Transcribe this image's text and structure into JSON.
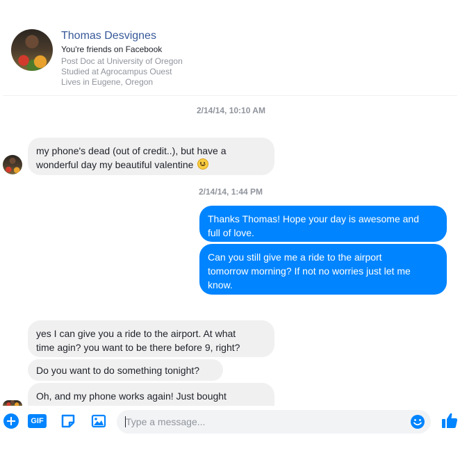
{
  "profile": {
    "name": "Thomas Desvignes",
    "friends_line": "You're friends on Facebook",
    "details": [
      "Post Doc at University of Oregon",
      "Studied at Agrocampus Ouest",
      "Lives in Eugene, Oregon"
    ]
  },
  "timestamps": [
    "2/14/14, 10:10 AM",
    "2/14/14, 1:44 PM"
  ],
  "messages": {
    "m1_line1": "my phone's dead (out of credit..), but have a",
    "m1_line2": "wonderful day my beautiful valentine",
    "m2_line1": "Thanks Thomas! Hope your day is awesome and",
    "m2_line2": "full of love.",
    "m3_line1": "Can you still give me a ride to the airport",
    "m3_line2": "tomorrow morning? If not no worries just let me",
    "m3_line3": "know.",
    "m4_line1": "yes I can give you a ride to the airport. At what",
    "m4_line2": "time agin? you want to be there before 9, right?",
    "m5_line1": "Do you want to do something tonight?",
    "m6_line1": "Oh, and my phone works again! Just bought"
  },
  "composer": {
    "placeholder": "Type a message...",
    "gif_label": "GIF",
    "icons": [
      "plus-icon",
      "gif-icon",
      "sticker-icon",
      "photo-icon",
      "emoji-icon",
      "thumbs-up-icon"
    ]
  },
  "colors": {
    "accent": "#0084ff",
    "incoming_bubble": "#f1f0f0",
    "name_link": "#365899",
    "muted_text": "#90949c"
  }
}
